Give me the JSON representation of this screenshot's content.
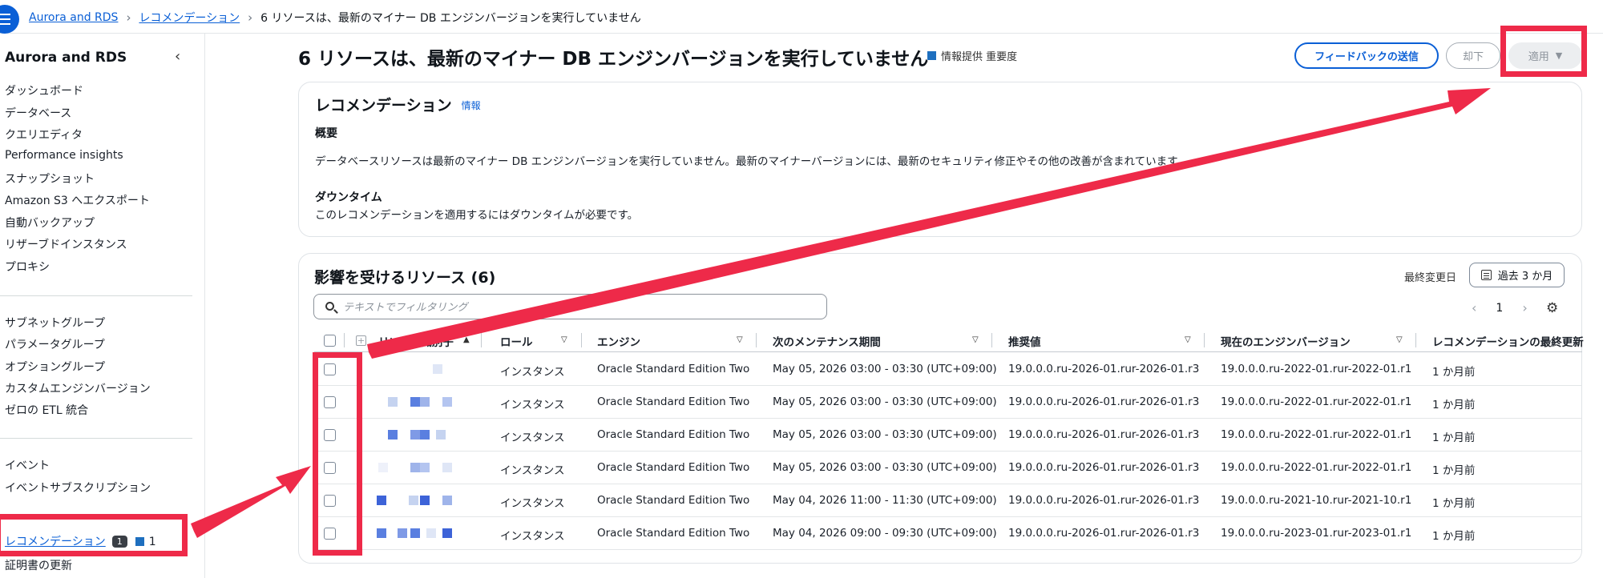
{
  "breadcrumb": {
    "items": [
      "Aurora and RDS",
      "レコメンデーション"
    ],
    "current": "6 リソースは、最新のマイナー DB エンジンバージョンを実行していません"
  },
  "sidebar": {
    "title": "Aurora and RDS",
    "group1": [
      "ダッシュボード",
      "データベース",
      "クエリエディタ",
      "Performance insights",
      "スナップショット",
      "Amazon S3 へエクスポート",
      "自動バックアップ",
      "リザーブドインスタンス",
      "プロキシ"
    ],
    "group2": [
      "サブネットグループ",
      "パラメータグループ",
      "オプショングループ",
      "カスタムエンジンバージョン",
      "ゼロの ETL 統合"
    ],
    "group3": [
      "イベント",
      "イベントサブスクリプション"
    ],
    "active": {
      "label": "レコメンデーション",
      "count": "1",
      "severity_count": "1"
    },
    "next": "証明書の更新"
  },
  "page": {
    "title": "6 リソースは、最新のマイナー DB エンジンバージョンを実行していません",
    "severity": "情報提供 重要度",
    "feedback_btn": "フィードバックの送信",
    "dismiss_btn": "却下",
    "apply_btn": "適用"
  },
  "recommendation": {
    "heading": "レコメンデーション",
    "info": "情報",
    "overview_label": "概要",
    "overview_text": "データベースリソースは最新のマイナー DB エンジンバージョンを実行していません。最新のマイナーバージョンには、最新のセキュリティ修正やその他の改善が含まれています。",
    "downtime_label": "ダウンタイム",
    "downtime_text": "このレコメンデーションを適用するにはダウンタイムが必要です。"
  },
  "resources": {
    "heading": "影響を受けるリソース (6)",
    "last_modified_label": "最終変更日",
    "range_btn": "過去 3 か月",
    "search_placeholder": "テキストでフィルタリング",
    "page_number": "1",
    "columns": [
      "リソース識別子",
      "ロール",
      "エンジン",
      "次のメンテナンス期間",
      "推奨値",
      "現在のエンジンバージョン",
      "レコメンデーションの最終更新"
    ],
    "rows": [
      {
        "role": "インスタンス",
        "engine": "Oracle Standard Edition Two",
        "window": "May 05, 2026 03:00 - 03:30 (UTC+09:00)",
        "recommended": "19.0.0.0.ru-2026-01.rur-2026-01.r3",
        "current": "19.0.0.0.ru-2022-01.rur-2022-01.r1",
        "updated": "1 か月前"
      },
      {
        "role": "インスタンス",
        "engine": "Oracle Standard Edition Two",
        "window": "May 05, 2026 03:00 - 03:30 (UTC+09:00)",
        "recommended": "19.0.0.0.ru-2026-01.rur-2026-01.r3",
        "current": "19.0.0.0.ru-2022-01.rur-2022-01.r1",
        "updated": "1 か月前"
      },
      {
        "role": "インスタンス",
        "engine": "Oracle Standard Edition Two",
        "window": "May 05, 2026 03:00 - 03:30 (UTC+09:00)",
        "recommended": "19.0.0.0.ru-2026-01.rur-2026-01.r3",
        "current": "19.0.0.0.ru-2022-01.rur-2022-01.r1",
        "updated": "1 か月前"
      },
      {
        "role": "インスタンス",
        "engine": "Oracle Standard Edition Two",
        "window": "May 05, 2026 03:00 - 03:30 (UTC+09:00)",
        "recommended": "19.0.0.0.ru-2026-01.rur-2026-01.r3",
        "current": "19.0.0.0.ru-2022-01.rur-2022-01.r1",
        "updated": "1 か月前"
      },
      {
        "role": "インスタンス",
        "engine": "Oracle Standard Edition Two",
        "window": "May 04, 2026 11:00 - 11:30 (UTC+09:00)",
        "recommended": "19.0.0.0.ru-2026-01.rur-2026-01.r3",
        "current": "19.0.0.0.ru-2021-10.rur-2021-10.r1",
        "updated": "1 か月前"
      },
      {
        "role": "インスタンス",
        "engine": "Oracle Standard Edition Two",
        "window": "May 04, 2026 09:00 - 09:30 (UTC+09:00)",
        "recommended": "19.0.0.0.ru-2026-01.rur-2026-01.r3",
        "current": "19.0.0.0.ru-2023-01.rur-2023-01.r1",
        "updated": "1 か月前"
      }
    ]
  },
  "colors": {
    "accent": "#0a5fd6",
    "annotation": "#ee2a49",
    "severity": "#1e6fbf"
  }
}
